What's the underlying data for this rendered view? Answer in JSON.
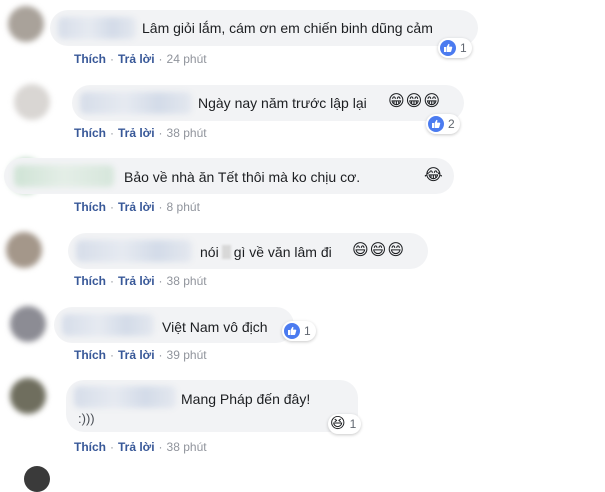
{
  "actions": {
    "like_label": "Thích",
    "reply_label": "Trả lời",
    "separator": "·"
  },
  "comments": [
    {
      "text": "Lâm giỏi lắm, cám ơn em chiến binh dũng cảm",
      "emojis": "",
      "reaction": "like-icon",
      "reaction_count": "1",
      "time": "24 phút"
    },
    {
      "text": "Ngày nay năm trước lập lại",
      "emojis": "😁😁😁",
      "reaction": "like-icon",
      "reaction_count": "2",
      "time": "38 phút"
    },
    {
      "text": "Bảo về nhà ăn Tết thôi mà ko chịu cơ.",
      "emojis": "😂",
      "reaction": "",
      "reaction_count": "",
      "time": "8 phút"
    },
    {
      "text_a": "nói",
      "text_b": "gì về văn lâm đi",
      "emojis": "😄😄😄",
      "reaction": "",
      "reaction_count": "",
      "time": "38 phút"
    },
    {
      "text": "Việt Nam vô địch",
      "emojis": "",
      "reaction": "like-icon",
      "reaction_count": "1",
      "time": "39 phút"
    },
    {
      "text": "Mang Pháp đến đây!",
      "text_line2": ":)))",
      "emojis": "",
      "reaction": "haha-icon",
      "reaction_count": "1",
      "time": "38 phút"
    }
  ],
  "colors": {
    "bubble": "#f2f3f5",
    "link": "#385898",
    "meta": "#90949c",
    "like_blue": "#4b7bf0"
  }
}
